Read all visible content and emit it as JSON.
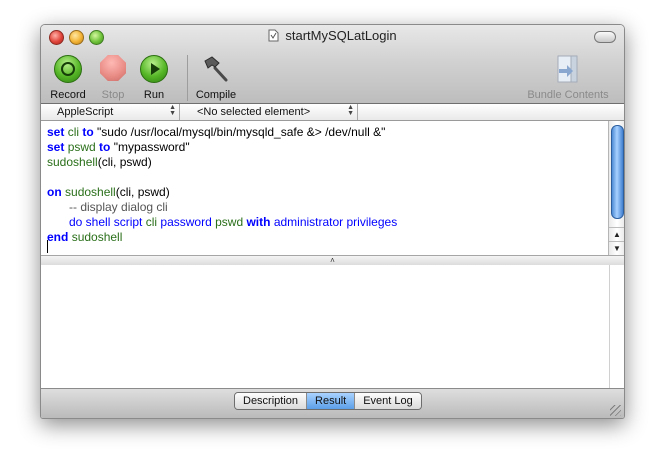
{
  "window": {
    "title": "startMySQLatLogin"
  },
  "toolbar": {
    "record_label": "Record",
    "stop_label": "Stop",
    "run_label": "Run",
    "compile_label": "Compile",
    "bundle_label": "Bundle Contents"
  },
  "navbar": {
    "language": "AppleScript",
    "element": "<No selected element>"
  },
  "code": {
    "l1_kw": "set",
    "l1_var": "cli",
    "l1_to": "to",
    "l1_str": "\"sudo /usr/local/mysql/bin/mysqld_safe &> /dev/null &\"",
    "l2_kw": "set",
    "l2_var": "pswd",
    "l2_to": "to",
    "l2_str": "\"mypassword\"",
    "l3_call": "sudoshell",
    "l3_args": "(cli, pswd)",
    "l5_kw": "on",
    "l5_name": "sudoshell",
    "l5_args": "(cli, pswd)",
    "l6_comment": "-- display dialog cli",
    "l7_cmd": "do shell script",
    "l7_cli": "cli",
    "l7_password": "password",
    "l7_pswd": "pswd",
    "l7_with": "with",
    "l7_admin": "administrator privileges",
    "l8_kw": "end",
    "l8_name": "sudoshell"
  },
  "tabs": [
    "Description",
    "Result",
    "Event Log"
  ],
  "active_tab": "Result"
}
